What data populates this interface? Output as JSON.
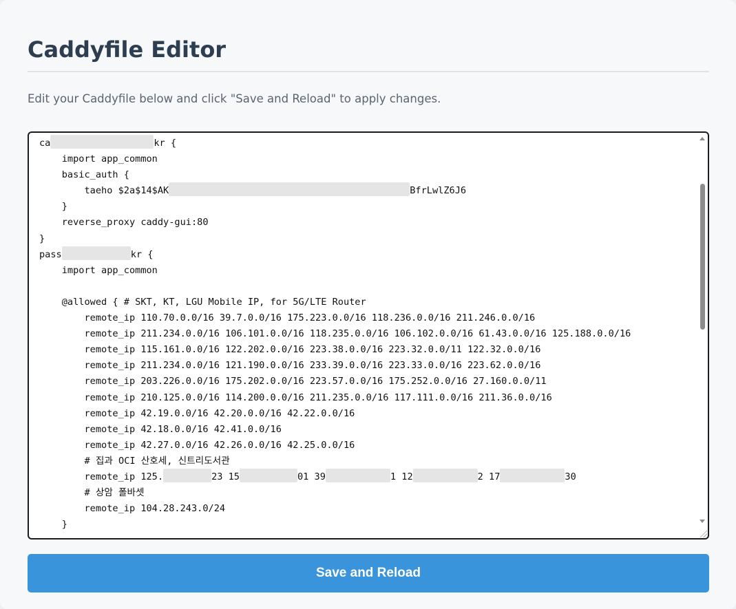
{
  "page": {
    "title": "Caddyfile Editor",
    "instructions": "Edit your Caddyfile below and click \"Save and Reload\" to apply changes."
  },
  "editor": {
    "lines": [
      [
        {
          "t": "ca"
        },
        {
          "r": 150
        },
        {
          "t": "kr {"
        }
      ],
      [
        {
          "t": "    import app_common"
        }
      ],
      [
        {
          "t": "    basic_auth {"
        }
      ],
      [
        {
          "t": "        taeho $2a$14$AK"
        },
        {
          "r": 350
        },
        {
          "t": "BfrLwlZ6J6"
        }
      ],
      [
        {
          "t": "    }"
        }
      ],
      [
        {
          "t": "    reverse_proxy caddy-gui:80"
        }
      ],
      [
        {
          "t": "}"
        }
      ],
      [
        {
          "t": "pass"
        },
        {
          "r": 100
        },
        {
          "t": "kr {"
        }
      ],
      [
        {
          "t": "    import app_common"
        }
      ],
      [
        {
          "t": ""
        }
      ],
      [
        {
          "t": "    @allowed { # SKT, KT, LGU Mobile IP, for 5G/LTE Router"
        }
      ],
      [
        {
          "t": "        remote_ip 110.70.0.0/16 39.7.0.0/16 175.223.0.0/16 118.236.0.0/16 211.246.0.0/16"
        }
      ],
      [
        {
          "t": "        remote_ip 211.234.0.0/16 106.101.0.0/16 118.235.0.0/16 106.102.0.0/16 61.43.0.0/16 125.188.0.0/16"
        }
      ],
      [
        {
          "t": "        remote_ip 115.161.0.0/16 122.202.0.0/16 223.38.0.0/16 223.32.0.0/11 122.32.0.0/16"
        }
      ],
      [
        {
          "t": "        remote_ip 211.234.0.0/16 121.190.0.0/16 233.39.0.0/16 223.33.0.0/16 223.62.0.0/16"
        }
      ],
      [
        {
          "t": "        remote_ip 203.226.0.0/16 175.202.0.0/16 223.57.0.0/16 175.252.0.0/16 27.160.0.0/11"
        }
      ],
      [
        {
          "t": "        remote_ip 210.125.0.0/16 114.200.0.0/16 211.235.0.0/16 117.111.0.0/16 211.36.0.0/16"
        }
      ],
      [
        {
          "t": "        remote_ip 42.19.0.0/16 42.20.0.0/16 42.22.0.0/16"
        }
      ],
      [
        {
          "t": "        remote_ip 42.18.0.0/16 42.41.0.0/16"
        }
      ],
      [
        {
          "t": "        remote_ip 42.27.0.0/16 42.26.0.0/16 42.25.0.0/16"
        }
      ],
      [
        {
          "t": "        # 집과 OCI 산호세, 신트리도서관"
        }
      ],
      [
        {
          "t": "        remote_ip 125."
        },
        {
          "r": 70
        },
        {
          "t": "23 15"
        },
        {
          "r": 84
        },
        {
          "t": "01 39"
        },
        {
          "r": 94
        },
        {
          "t": "1 12"
        },
        {
          "r": 94
        },
        {
          "t": "2 17"
        },
        {
          "r": 94
        },
        {
          "t": "30"
        }
      ],
      [
        {
          "t": "        # 상암 폴바셋"
        }
      ],
      [
        {
          "t": "        remote_ip 104.28.243.0/24"
        }
      ],
      [
        {
          "t": "    }"
        }
      ]
    ]
  },
  "actions": {
    "save_label": "Save and Reload"
  }
}
